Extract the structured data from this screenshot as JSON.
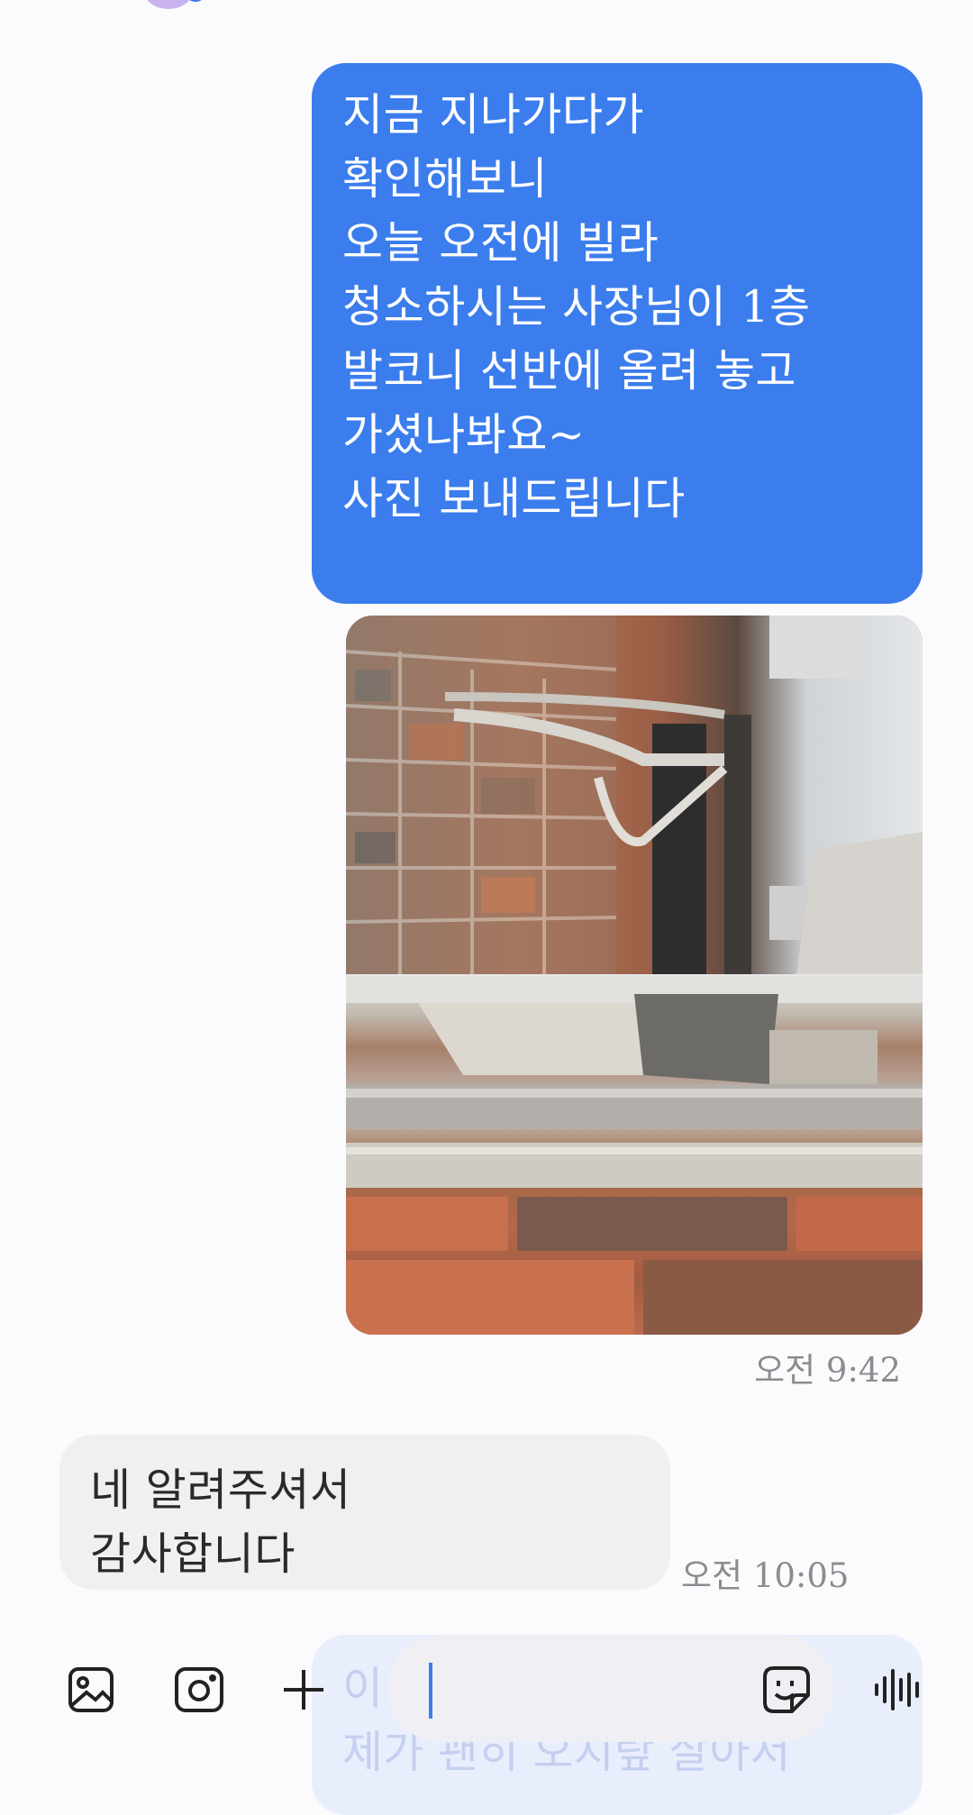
{
  "messages": {
    "outgoing_text": {
      "lines": [
        "지금 지나가다가",
        "확인해보니",
        "오늘 오전에 빌라",
        "청소하시는 사장님이 1층",
        "발코니 선반에 올려 놓고",
        "가셨나봐요~",
        "사진 보내드립니다"
      ]
    },
    "outgoing_time": "오전 9:42",
    "incoming_text": {
      "lines": [
        "네 알려주셔서",
        "감사합니다"
      ]
    },
    "incoming_time": "오전 10:05",
    "partial_text": {
      "lines": [
        "이",
        "제가 괜히 오지랖 살아서"
      ]
    }
  },
  "composer": {
    "icons": [
      "gallery-icon",
      "camera-icon",
      "plus-icon",
      "sticker-icon",
      "voice-icon"
    ]
  },
  "colors": {
    "outgoing_bubble": "#3b7ded",
    "incoming_bubble": "#f0f0f1",
    "background": "#fbfbfd"
  }
}
